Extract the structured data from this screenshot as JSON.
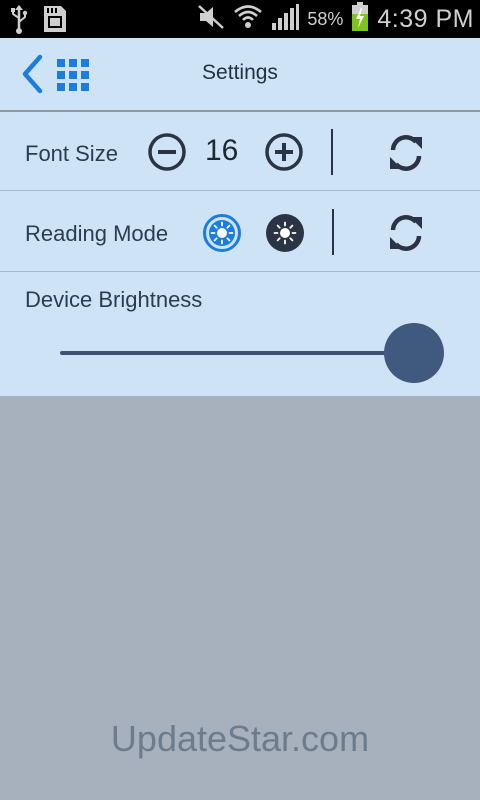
{
  "status_bar": {
    "battery_percent": "58%",
    "time": "4:39 PM",
    "icons": [
      "usb-icon",
      "sd-card-icon",
      "mute-icon",
      "wifi-icon",
      "signal-icon",
      "battery-charging-icon"
    ]
  },
  "header": {
    "title": "Settings",
    "back_icon": "chevron-left-icon",
    "grid_icon": "grid-icon",
    "accent_color": "#1b7de0"
  },
  "settings": {
    "font_size": {
      "label": "Font Size",
      "value": "16",
      "icons": [
        "minus-circle-icon",
        "plus-circle-icon",
        "refresh-icon"
      ]
    },
    "reading_mode": {
      "label": "Reading Mode",
      "icons": [
        "day-mode-icon",
        "night-mode-icon",
        "refresh-icon"
      ],
      "selected": "day"
    },
    "device_brightness": {
      "label": "Device Brightness",
      "level": 1.0
    }
  },
  "watermark": "UpdateStar.com"
}
